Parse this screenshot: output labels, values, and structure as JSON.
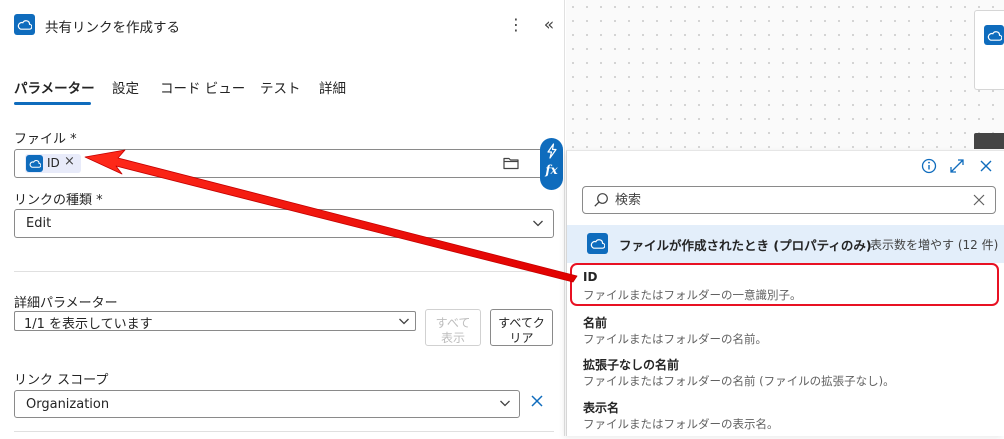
{
  "header": {
    "title": "共有リンクを作成する",
    "more_icon": "more-vertical-icon",
    "collapse_icon": "double-chevron-left-icon"
  },
  "tabs": [
    {
      "label": "パラメーター",
      "active": true
    },
    {
      "label": "設定",
      "active": false
    },
    {
      "label": "コード ビュー",
      "active": false
    },
    {
      "label": "テスト",
      "active": false
    },
    {
      "label": "詳細",
      "active": false
    }
  ],
  "file_field": {
    "label": "ファイル *",
    "token_label": "ID",
    "token_remove": "×"
  },
  "link_type": {
    "label": "リンクの種類 *",
    "value": "Edit"
  },
  "advanced": {
    "label": "詳細パラメーター",
    "value": "1/1 を表示しています",
    "show_all_line1": "すべて",
    "show_all_line2": "表示",
    "clear_all_line1": "すべてク",
    "clear_all_line2": "リア"
  },
  "link_scope": {
    "label": "リンク スコープ",
    "value": "Organization"
  },
  "side_buttons": {
    "lightning_icon": "lightning-icon",
    "fx_label": "fx"
  },
  "popup": {
    "search_placeholder": "検索",
    "group": {
      "title": "ファイルが作成されたとき (プロパティのみ)",
      "show_more": "表示数を増やす (12 件)"
    },
    "items": [
      {
        "name": "ID",
        "desc": "ファイルまたはフォルダーの一意識別子。"
      },
      {
        "name": "名前",
        "desc": "ファイルまたはフォルダーの名前。"
      },
      {
        "name": "拡張子なしの名前",
        "desc": "ファイルまたはフォルダーの名前 (ファイルの拡張子なし)。"
      },
      {
        "name": "表示名",
        "desc": "ファイルまたはフォルダーの表示名。"
      }
    ]
  },
  "colors": {
    "accent": "#0f6cbd",
    "annotation": "#e81123"
  }
}
